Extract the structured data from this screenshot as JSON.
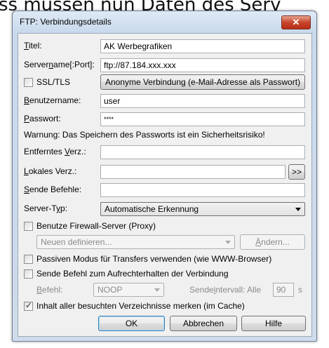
{
  "background_text": "ss müssen nun Daten des Serv",
  "window": {
    "title": "FTP: Verbindungsdetails",
    "close_glyph": "✕"
  },
  "form": {
    "title_label_pre": "",
    "title_label_u": "T",
    "title_label_post": "itel:",
    "title_value": "AK Werbegrafiken",
    "server_label_pre": "Server",
    "server_label_u": "n",
    "server_label_post": "ame[:Port]:",
    "server_value": "ftp://87.184.xxx.xxx",
    "ssl_label": "SSL/TLS",
    "anon_button": "Anonyme Verbindung (e-Mail-Adresse als Passwort)",
    "user_label_pre": "",
    "user_label_u": "B",
    "user_label_post": "enutzername:",
    "user_value": "user",
    "pass_label_pre": "",
    "pass_label_u": "P",
    "pass_label_post": "asswort:",
    "pass_value": "****",
    "warning": "Warnung: Das Speichern des Passworts ist ein Sicherheitsrisiko!",
    "remote_label_pre": "Entferntes ",
    "remote_label_u": "V",
    "remote_label_post": "erz.:",
    "remote_value": "",
    "local_label_pre": "",
    "local_label_u": "L",
    "local_label_post": "okales Verz.:",
    "local_value": "",
    "browse_button": ">>",
    "send_label_pre": "",
    "send_label_u": "S",
    "send_label_post": "ende Befehle:",
    "send_value": "",
    "type_label_pre": "Server-T",
    "type_label_u": "y",
    "type_label_post": "p:",
    "type_value": "Automatische Erkennung",
    "firewall_label": "Benutze Firewall-Server (Proxy)",
    "firewall_select": "Neuen definieren...",
    "change_button_pre": "",
    "change_button_u": "Ä",
    "change_button_post": "ndern...",
    "passive_label": "Passiven Modus für Transfers verwenden (wie WWW-Browser)",
    "keepalive_label": "Sende Befehl zum Aufrechterhalten der Verbindung",
    "command_label_pre": "",
    "command_label_u": "B",
    "command_label_post": "efehl:",
    "command_value": "NOOP",
    "interval_label_pre": "Sende",
    "interval_label_u": "i",
    "interval_label_post": "ntervall: Alle",
    "interval_value": "90",
    "interval_unit": "s",
    "cache_label": "Inhalt aller besuchten Verzeichnisse merken (im Cache)",
    "cache_checked": true,
    "ssl_checked": false,
    "firewall_checked": false,
    "passive_checked": false,
    "keepalive_checked": false
  },
  "buttons": {
    "ok": "OK",
    "cancel": "Abbrechen",
    "help": "Hilfe"
  }
}
